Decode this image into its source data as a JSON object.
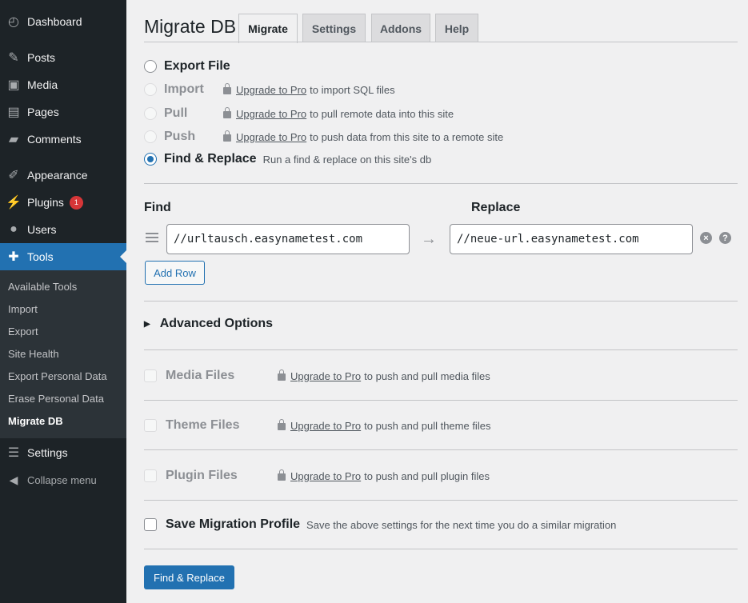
{
  "sidebar": {
    "menu": [
      {
        "label": "Dashboard",
        "icon": "dashboard-icon"
      },
      {
        "label": "Posts",
        "icon": "pin-icon"
      },
      {
        "label": "Media",
        "icon": "media-icon"
      },
      {
        "label": "Pages",
        "icon": "pages-icon"
      },
      {
        "label": "Comments",
        "icon": "comment-icon"
      },
      {
        "label": "Appearance",
        "icon": "brush-icon"
      },
      {
        "label": "Plugins",
        "icon": "plug-icon",
        "badge": "1"
      },
      {
        "label": "Users",
        "icon": "user-icon"
      },
      {
        "label": "Tools",
        "icon": "wrench-icon"
      },
      {
        "label": "Settings",
        "icon": "sliders-icon"
      },
      {
        "label": "Collapse menu",
        "icon": "collapse-icon"
      }
    ],
    "submenu": [
      "Available Tools",
      "Import",
      "Export",
      "Site Health",
      "Export Personal Data",
      "Erase Personal Data",
      "Migrate DB"
    ]
  },
  "page": {
    "title": "Migrate DB",
    "tabs": [
      "Migrate",
      "Settings",
      "Addons",
      "Help"
    ]
  },
  "actions": [
    {
      "label": "Export File",
      "link": "",
      "hint": ""
    },
    {
      "label": "Import",
      "link": "Upgrade to Pro",
      "hint": "to import SQL files"
    },
    {
      "label": "Pull",
      "link": "Upgrade to Pro",
      "hint": "to pull remote data into this site"
    },
    {
      "label": "Push",
      "link": "Upgrade to Pro",
      "hint": "to push data from this site to a remote site"
    },
    {
      "label": "Find & Replace",
      "link": "",
      "hint": "Run a find & replace on this site's db"
    }
  ],
  "find_replace": {
    "find_label": "Find",
    "replace_label": "Replace",
    "find_value": "//urltausch.easynametest.com",
    "replace_value": "//neue-url.easynametest.com",
    "add_row": "Add Row",
    "remove_icon": "×",
    "help_icon": "?"
  },
  "advanced": "Advanced Options",
  "files": [
    {
      "label": "Media Files",
      "link": "Upgrade to Pro",
      "hint": "to push and pull media files"
    },
    {
      "label": "Theme Files",
      "link": "Upgrade to Pro",
      "hint": "to push and pull theme files"
    },
    {
      "label": "Plugin Files",
      "link": "Upgrade to Pro",
      "hint": "to push and pull plugin files"
    }
  ],
  "profile": {
    "label": "Save Migration Profile",
    "hint": "Save the above settings for the next time you do a similar migration"
  },
  "submit": "Find & Replace",
  "colors": {
    "accent": "#2271b1",
    "sidebar": "#1d2327",
    "badge": "#d63638"
  }
}
